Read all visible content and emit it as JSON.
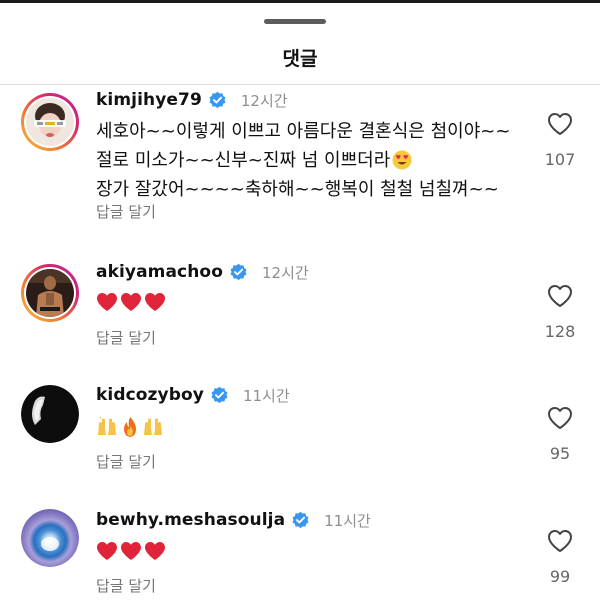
{
  "sheet": {
    "title": "댓글"
  },
  "comments": [
    {
      "username": "kimjihye79",
      "time": "12시간",
      "text": "세호아~~이렇게 이쁘고 아름다운 결혼식은 첨이야~~절로 미소가~~신부~진짜 넘 이쁘더라",
      "text_tail": "장가 잘갔어~~~~축하해~~행복이 철철 넘칠껴~~",
      "trailing_emoji": "smiling-face-with-heart-eyes",
      "reply_label": "답글 달기",
      "likes": "107",
      "verified": true
    },
    {
      "username": "akiyamachoo",
      "time": "12시간",
      "emojis": [
        "red-heart",
        "red-heart",
        "red-heart"
      ],
      "reply_label": "답글 달기",
      "likes": "128",
      "verified": true
    },
    {
      "username": "kidcozyboy",
      "time": "11시간",
      "emojis": [
        "raising-hands",
        "fire",
        "raising-hands"
      ],
      "reply_label": "답글 달기",
      "likes": "95",
      "verified": true
    },
    {
      "username": "bewhy.meshasoulja",
      "time": "11시간",
      "emojis": [
        "red-heart",
        "red-heart",
        "red-heart"
      ],
      "reply_label": "답글 달기",
      "likes": "99",
      "verified": true
    }
  ],
  "colors": {
    "verified_blue": "#3897f0",
    "heart_red": "#e0243a",
    "muted_text": "#8e8e8e"
  }
}
